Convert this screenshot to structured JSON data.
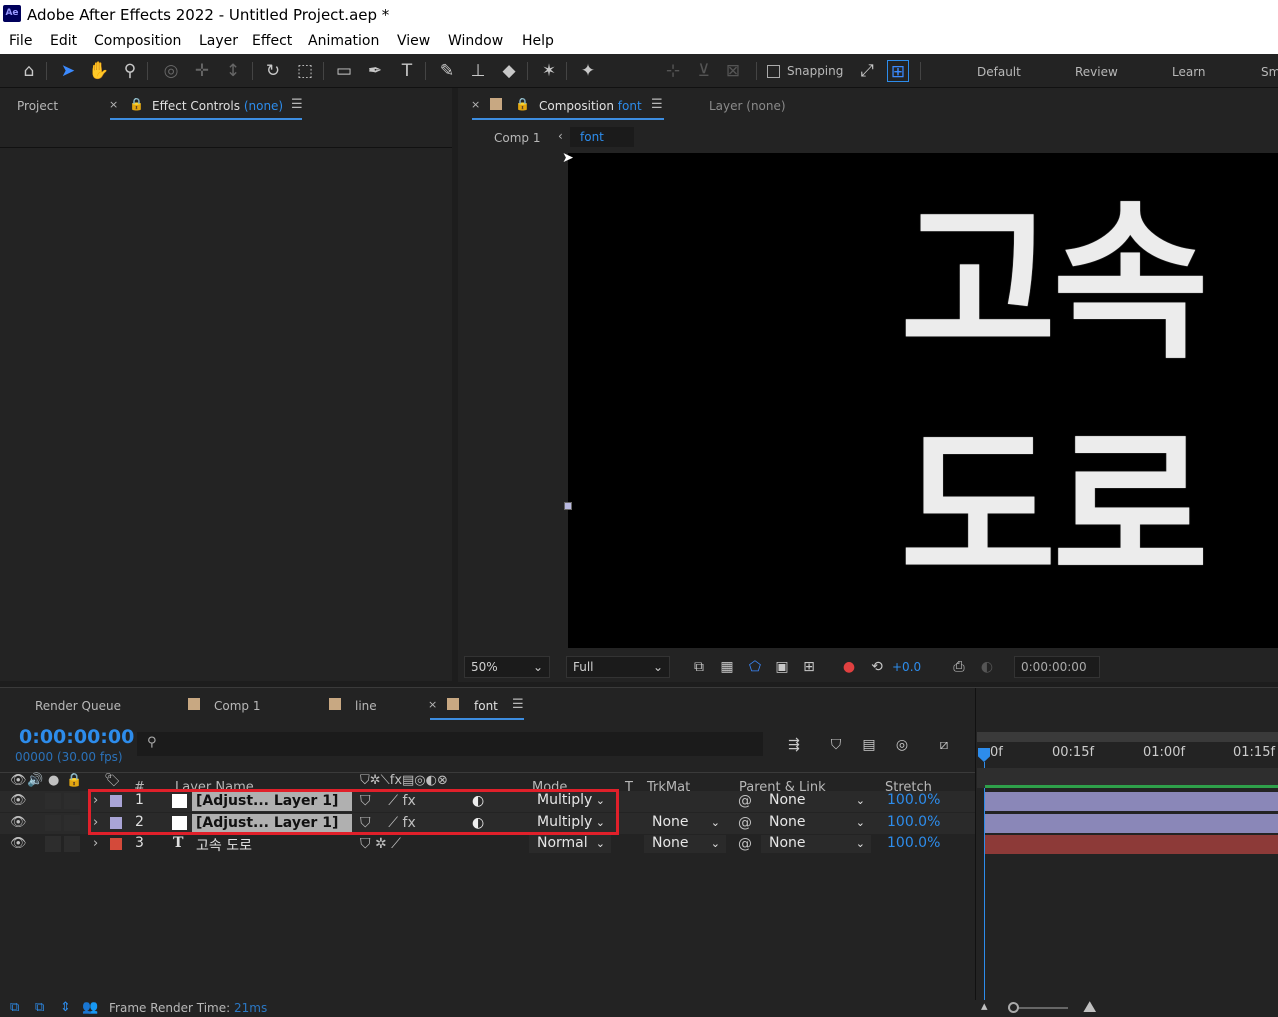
{
  "app": {
    "logo_text": "Ae",
    "title": "Adobe After Effects 2022 - Untitled Project.aep *"
  },
  "menu": [
    "File",
    "Edit",
    "Composition",
    "Layer",
    "Effect",
    "Animation",
    "View",
    "Window",
    "Help"
  ],
  "toolbar": {
    "snapping_label": "Snapping",
    "workspaces": [
      "Default",
      "Review",
      "Learn",
      "Sm"
    ]
  },
  "left_panel": {
    "project_tab": "Project",
    "effect_controls_label": "Effect Controls",
    "effect_controls_target": "(none)"
  },
  "comp_panel": {
    "composition_label": "Composition",
    "composition_name": "font",
    "layer_tab": "Layer (none)",
    "breadcrumbs": [
      "Comp 1",
      "font"
    ],
    "preview_text": [
      "고속",
      "도로"
    ],
    "zoom": "50%",
    "resolution": "Full",
    "exposure": "+0.0",
    "timecode": "0:00:00:00"
  },
  "timeline": {
    "tabs": [
      "Render Queue",
      "Comp 1",
      "line",
      "font"
    ],
    "current_time": "0:00:00:00",
    "frames": "00000 (30.00 fps)",
    "columns": {
      "layer_name": "Layer Name",
      "mode": "Mode",
      "t": "T",
      "trkmat": "TrkMat",
      "parent": "Parent & Link",
      "stretch": "Stretch",
      "number": "#"
    },
    "ruler": [
      "0f",
      "00:15f",
      "01:00f",
      "01:15f"
    ],
    "layers": [
      {
        "num": "1",
        "name": "[Adjust... Layer 1]",
        "mode": "Multiply",
        "trkmat": "",
        "parent": "None",
        "stretch": "100.0%",
        "color": "#a9a4d6",
        "bar_color": "#8a87b8"
      },
      {
        "num": "2",
        "name": "[Adjust... Layer 1]",
        "mode": "Multiply",
        "trkmat": "None",
        "parent": "None",
        "stretch": "100.0%",
        "color": "#a9a4d6",
        "bar_color": "#8a87b8"
      },
      {
        "num": "3",
        "name": "고속 도로",
        "mode": "Normal",
        "trkmat": "None",
        "parent": "None",
        "stretch": "100.0%",
        "color": "#d44a3a",
        "bar_color": "#8d3a38"
      }
    ]
  },
  "status_bar": {
    "label": "Frame Render Time:",
    "value": "21ms"
  },
  "colors": {
    "accent": "#2d8ceb",
    "highlight_box": "#e0202a",
    "tab_swatch": "#c8a882"
  }
}
